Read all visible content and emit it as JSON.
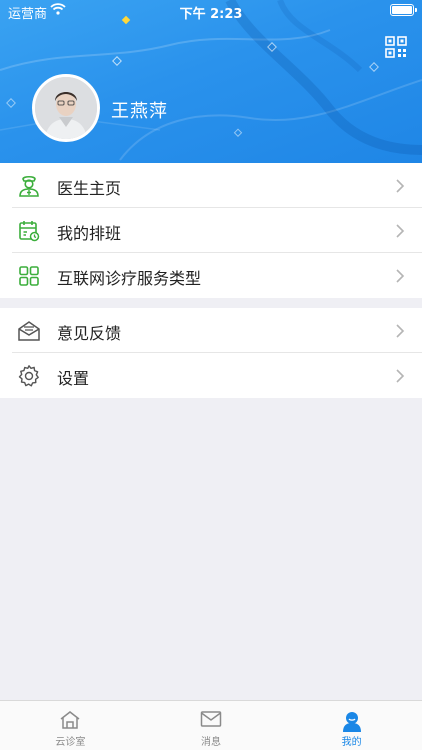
{
  "status_bar": {
    "carrier": "运营商",
    "time": "下午 2:23"
  },
  "profile": {
    "name": "王燕萍"
  },
  "menu_group_1": [
    {
      "label": "医生主页",
      "icon": "doctor-icon"
    },
    {
      "label": "我的排班",
      "icon": "calendar-icon"
    },
    {
      "label": "互联网诊疗服务类型",
      "icon": "grid-icon"
    }
  ],
  "menu_group_2": [
    {
      "label": "意见反馈",
      "icon": "feedback-mail-icon"
    },
    {
      "label": "设置",
      "icon": "gear-icon"
    }
  ],
  "tabbar": [
    {
      "label": "云诊室",
      "icon": "home-icon",
      "active": false
    },
    {
      "label": "消息",
      "icon": "mail-icon",
      "active": false
    },
    {
      "label": "我的",
      "icon": "user-icon",
      "active": true
    }
  ],
  "colors": {
    "header_blue": "#2a92ec",
    "icon_green": "#3cae3c",
    "active_blue": "#1a87e6"
  }
}
